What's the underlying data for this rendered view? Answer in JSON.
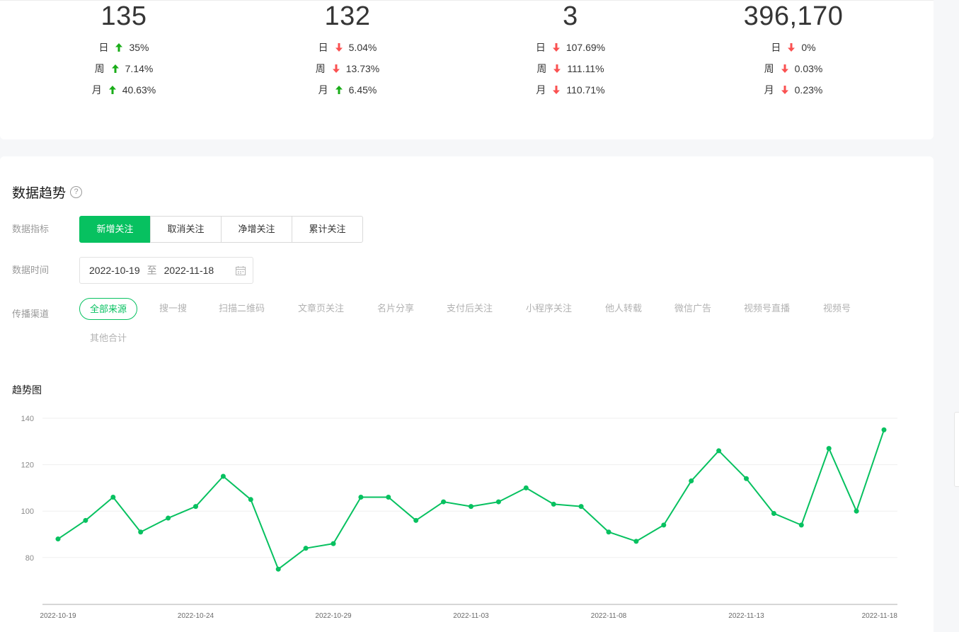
{
  "stats": [
    {
      "value": "135",
      "rows": [
        {
          "label": "日",
          "dir": "up",
          "pct": "35%"
        },
        {
          "label": "周",
          "dir": "up",
          "pct": "7.14%"
        },
        {
          "label": "月",
          "dir": "up",
          "pct": "40.63%"
        }
      ]
    },
    {
      "value": "132",
      "rows": [
        {
          "label": "日",
          "dir": "down",
          "pct": "5.04%"
        },
        {
          "label": "周",
          "dir": "down",
          "pct": "13.73%"
        },
        {
          "label": "月",
          "dir": "up",
          "pct": "6.45%"
        }
      ]
    },
    {
      "value": "3",
      "rows": [
        {
          "label": "日",
          "dir": "down",
          "pct": "107.69%"
        },
        {
          "label": "周",
          "dir": "down",
          "pct": "111.11%"
        },
        {
          "label": "月",
          "dir": "down",
          "pct": "110.71%"
        }
      ]
    },
    {
      "value": "396,170",
      "rows": [
        {
          "label": "日",
          "dir": "down",
          "pct": "0%"
        },
        {
          "label": "周",
          "dir": "down",
          "pct": "0.03%"
        },
        {
          "label": "月",
          "dir": "down",
          "pct": "0.23%"
        }
      ]
    }
  ],
  "colors": {
    "up": "#1aad19",
    "down": "#fa5151",
    "accent": "#07c160"
  },
  "section": {
    "title": "数据趋势",
    "help_icon": "question-circle-icon",
    "metric_label": "数据指标",
    "time_label": "数据时间",
    "channel_label": "传播渠道",
    "chart_title": "趋势图"
  },
  "metrics": [
    {
      "label": "新增关注",
      "active": true
    },
    {
      "label": "取消关注",
      "active": false
    },
    {
      "label": "净增关注",
      "active": false
    },
    {
      "label": "累计关注",
      "active": false
    }
  ],
  "date_range": {
    "start": "2022-10-19",
    "separator": "至",
    "end": "2022-11-18",
    "icon": "calendar-icon"
  },
  "channels": [
    {
      "label": "全部来源",
      "active": true
    },
    {
      "label": "搜一搜",
      "active": false
    },
    {
      "label": "扫描二维码",
      "active": false
    },
    {
      "label": "文章页关注",
      "active": false
    },
    {
      "label": "名片分享",
      "active": false
    },
    {
      "label": "支付后关注",
      "active": false
    },
    {
      "label": "小程序关注",
      "active": false
    },
    {
      "label": "他人转载",
      "active": false
    },
    {
      "label": "微信广告",
      "active": false
    },
    {
      "label": "视频号直播",
      "active": false
    },
    {
      "label": "视频号",
      "active": false
    },
    {
      "label": "其他合计",
      "active": false
    }
  ],
  "chart_data": {
    "type": "line",
    "x": [
      "2022-10-19",
      "2022-10-20",
      "2022-10-21",
      "2022-10-22",
      "2022-10-23",
      "2022-10-24",
      "2022-10-25",
      "2022-10-26",
      "2022-10-27",
      "2022-10-28",
      "2022-10-29",
      "2022-10-30",
      "2022-10-31",
      "2022-11-01",
      "2022-11-02",
      "2022-11-03",
      "2022-11-04",
      "2022-11-05",
      "2022-11-06",
      "2022-11-07",
      "2022-11-08",
      "2022-11-09",
      "2022-11-10",
      "2022-11-11",
      "2022-11-12",
      "2022-11-13",
      "2022-11-14",
      "2022-11-15",
      "2022-11-16",
      "2022-11-17",
      "2022-11-18"
    ],
    "values": [
      88,
      96,
      106,
      91,
      97,
      102,
      115,
      105,
      75,
      84,
      86,
      106,
      106,
      96,
      104,
      102,
      104,
      110,
      103,
      102,
      91,
      87,
      94,
      113,
      126,
      114,
      99,
      94,
      127,
      100,
      135
    ],
    "xticks": [
      "2022-10-19",
      "2022-10-24",
      "2022-10-29",
      "2022-11-03",
      "2022-11-08",
      "2022-11-13",
      "2022-11-18"
    ],
    "yticks": [
      80,
      100,
      120,
      140
    ],
    "ylim": [
      60,
      140
    ],
    "grid": true,
    "color": "#07c160"
  }
}
